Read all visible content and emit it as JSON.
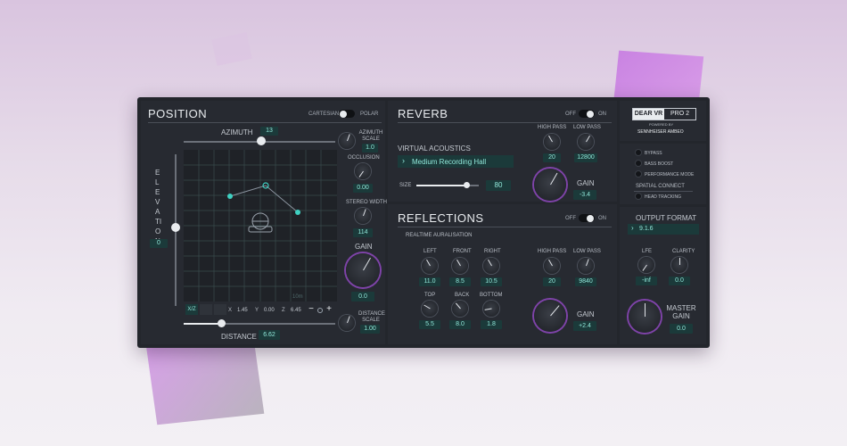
{
  "position": {
    "title": "POSITION",
    "toggle_left": "CARTESIAN",
    "toggle_right": "POLAR",
    "azimuth_label": "AZIMUTH",
    "azimuth_value": "13",
    "elevation_label": "ELEVATION",
    "elevation_value": "0",
    "distance_label": "DISTANCE",
    "distance_value": "6.62",
    "azimuth_scale_label": "AZIMUTH SCALE",
    "azimuth_scale_value": "1.0",
    "occlusion_label": "OCCLUSION",
    "occlusion_value": "0.00",
    "stereo_width_label": "STEREO WIDTH",
    "stereo_width_value": "114",
    "gain_label": "GAIN",
    "gain_value": "0.0",
    "distance_scale_label": "DISTANCE SCALE",
    "distance_scale_value": "1.00",
    "grid_scale_label": "10m",
    "view_button": "X/Z",
    "x_label": "X",
    "x_value": "1.45",
    "y_label": "Y",
    "y_value": "0.00",
    "z_label": "Z",
    "z_value": "6.45",
    "zoom_minus": "−",
    "zoom_plus": "+"
  },
  "reverb": {
    "title": "REVERB",
    "toggle_left": "OFF",
    "toggle_right": "ON",
    "virtual_acoustics_label": "VIRTUAL ACOUSTICS",
    "preset": "Medium Recording Hall",
    "size_label": "SIZE",
    "size_value": "80",
    "high_pass_label": "HIGH PASS",
    "high_pass_value": "20",
    "low_pass_label": "LOW PASS",
    "low_pass_value": "12800",
    "gain_label": "GAIN",
    "gain_value": "-3.4"
  },
  "reflections": {
    "title": "REFLECTIONS",
    "toggle_left": "OFF",
    "toggle_right": "ON",
    "subtitle": "REALTIME AURALISATION",
    "left_label": "LEFT",
    "left_value": "11.0",
    "front_label": "FRONT",
    "front_value": "8.5",
    "right_label": "RIGHT",
    "right_value": "10.5",
    "top_label": "TOP",
    "top_value": "5.5",
    "back_label": "BACK",
    "back_value": "8.0",
    "bottom_label": "BOTTOM",
    "bottom_value": "1.8",
    "high_pass_label": "HIGH PASS",
    "high_pass_value": "20",
    "low_pass_label": "LOW PASS",
    "low_pass_value": "9840",
    "gain_label": "GAIN",
    "gain_value": "+2.4"
  },
  "brand": {
    "logo_left": "DEAR VR",
    "logo_right": "PRO 2",
    "powered_by": "POWERED BY",
    "sponsor": "SENNHEISER AMBEO"
  },
  "options": {
    "bypass": "BYPASS",
    "bass_boost": "BASS BOOST",
    "performance_mode": "PERFORMANCE MODE",
    "spatial_connect": "SPATIAL CONNECT",
    "head_tracking": "HEAD TRACKING"
  },
  "output": {
    "title": "OUTPUT FORMAT",
    "format": "9.1.6",
    "lfe_label": "LFE",
    "lfe_value": "-inf",
    "clarity_label": "CLARITY",
    "clarity_value": "0.0",
    "master_gain_label": "MASTER GAIN",
    "master_gain_value": "0.0"
  },
  "colors": {
    "accent_teal": "#3fd1c2",
    "accent_purple": "#c06ae0",
    "value_bg": "#1b3a3a"
  }
}
